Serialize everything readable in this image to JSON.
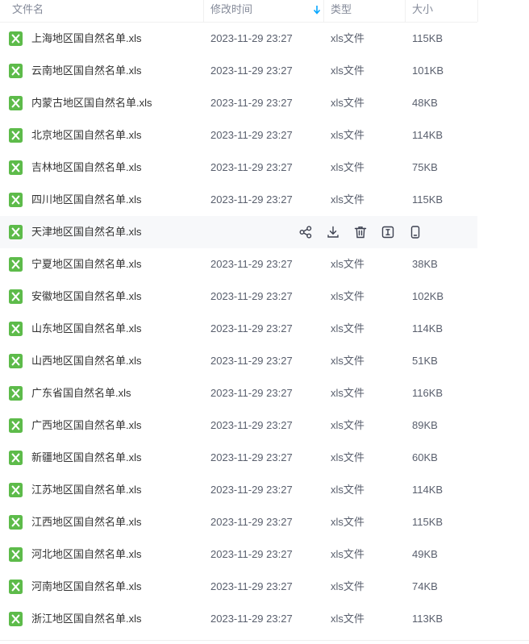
{
  "columns": {
    "name": "文件名",
    "time": "修改时间",
    "type": "类型",
    "size": "大小"
  },
  "colors": {
    "xls_icon": "#5dbb4a",
    "accent": "#06a7ff"
  },
  "icons": {
    "file": "excel-file-icon",
    "sort": "sort-descending-arrow-icon",
    "actions": [
      "share-icon",
      "download-icon",
      "delete-icon",
      "rename-icon",
      "send-to-phone-icon"
    ]
  },
  "files": [
    {
      "name": "上海地区国自然名单.xls",
      "time": "2023-11-29 23:27",
      "type": "xls文件",
      "size": "115KB"
    },
    {
      "name": "云南地区国自然名单.xls",
      "time": "2023-11-29 23:27",
      "type": "xls文件",
      "size": "101KB"
    },
    {
      "name": "内蒙古地区国自然名单.xls",
      "time": "2023-11-29 23:27",
      "type": "xls文件",
      "size": "48KB"
    },
    {
      "name": "北京地区国自然名单.xls",
      "time": "2023-11-29 23:27",
      "type": "xls文件",
      "size": "114KB"
    },
    {
      "name": "吉林地区国自然名单.xls",
      "time": "2023-11-29 23:27",
      "type": "xls文件",
      "size": "75KB"
    },
    {
      "name": "四川地区国自然名单.xls",
      "time": "2023-11-29 23:27",
      "type": "xls文件",
      "size": "115KB"
    },
    {
      "name": "天津地区国自然名单.xls",
      "time": "",
      "type": "",
      "size": "",
      "hovered": true
    },
    {
      "name": "宁夏地区国自然名单.xls",
      "time": "2023-11-29 23:27",
      "type": "xls文件",
      "size": "38KB"
    },
    {
      "name": "安徽地区国自然名单.xls",
      "time": "2023-11-29 23:27",
      "type": "xls文件",
      "size": "102KB"
    },
    {
      "name": "山东地区国自然名单.xls",
      "time": "2023-11-29 23:27",
      "type": "xls文件",
      "size": "114KB"
    },
    {
      "name": "山西地区国自然名单.xls",
      "time": "2023-11-29 23:27",
      "type": "xls文件",
      "size": "51KB"
    },
    {
      "name": "广东省国自然名单.xls",
      "time": "2023-11-29 23:27",
      "type": "xls文件",
      "size": "116KB"
    },
    {
      "name": "广西地区国自然名单.xls",
      "time": "2023-11-29 23:27",
      "type": "xls文件",
      "size": "89KB"
    },
    {
      "name": "新疆地区国自然名单.xls",
      "time": "2023-11-29 23:27",
      "type": "xls文件",
      "size": "60KB"
    },
    {
      "name": "江苏地区国自然名单.xls",
      "time": "2023-11-29 23:27",
      "type": "xls文件",
      "size": "114KB"
    },
    {
      "name": "江西地区国自然名单.xls",
      "time": "2023-11-29 23:27",
      "type": "xls文件",
      "size": "115KB"
    },
    {
      "name": "河北地区国自然名单.xls",
      "time": "2023-11-29 23:27",
      "type": "xls文件",
      "size": "49KB"
    },
    {
      "name": "河南地区国自然名单.xls",
      "time": "2023-11-29 23:27",
      "type": "xls文件",
      "size": "74KB"
    },
    {
      "name": "浙江地区国自然名单.xls",
      "time": "2023-11-29 23:27",
      "type": "xls文件",
      "size": "113KB"
    }
  ]
}
